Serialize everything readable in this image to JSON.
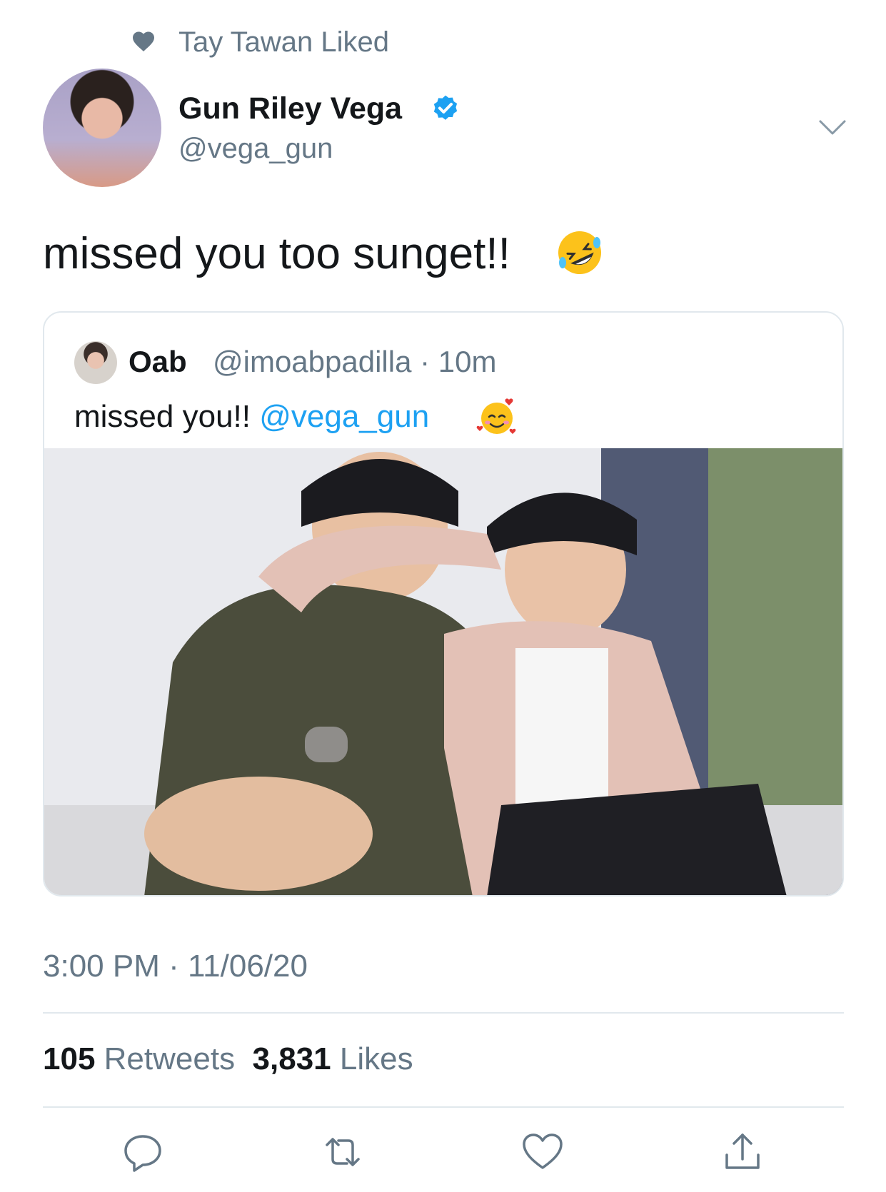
{
  "social_context": {
    "icon": "heart-icon",
    "text": "Tay Tawan Liked"
  },
  "author": {
    "display_name": "Gun Riley Vega",
    "handle": "@vega_gun",
    "verified_icon": "verified-badge-icon",
    "verified_color": "#1da1f2"
  },
  "tweet": {
    "text": "missed you too sunget!!",
    "emoji": "rolling-on-floor-laughing-emoji"
  },
  "quoted": {
    "name": "Oab",
    "handle": "@imoabpadilla",
    "time": "10m",
    "text": "missed you!!",
    "mention": "@vega_gun",
    "emoji": "smiling-face-with-hearts-emoji"
  },
  "timestamp": "3:00 PM · 11/06/20",
  "stats": {
    "retweets_count": "105",
    "retweets_label": "Retweets",
    "likes_count": "3,831",
    "likes_label": "Likes"
  },
  "actions": [
    "reply-icon",
    "retweet-icon",
    "like-icon",
    "share-icon"
  ],
  "colors": {
    "accent": "#1da1f2",
    "secondary_text": "#657786",
    "divider": "#e1e8ed"
  }
}
